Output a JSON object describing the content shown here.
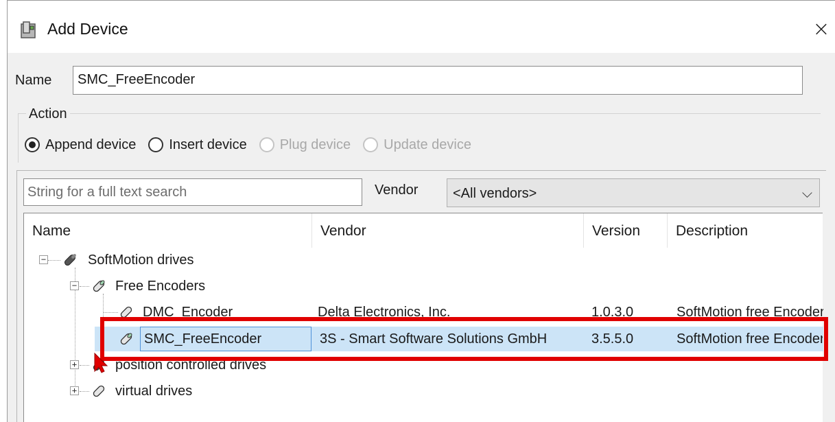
{
  "window": {
    "title": "Add Device",
    "close_glyph": "×"
  },
  "name_field": {
    "label": "Name",
    "value": "SMC_FreeEncoder"
  },
  "action": {
    "label": "Action",
    "options": [
      {
        "label": "Append device",
        "checked": true,
        "disabled": false
      },
      {
        "label": "Insert device",
        "checked": false,
        "disabled": false
      },
      {
        "label": "Plug device",
        "checked": false,
        "disabled": true
      },
      {
        "label": "Update device",
        "checked": false,
        "disabled": true
      }
    ]
  },
  "search": {
    "placeholder": "String for a full text search"
  },
  "vendor": {
    "label": "Vendor",
    "selected": "<All vendors>",
    "chevron": "⌵"
  },
  "table": {
    "columns": [
      "Name",
      "Vendor",
      "Version",
      "Description"
    ],
    "tree": {
      "softmotion_drives": "SoftMotion drives",
      "free_encoders": "Free Encoders",
      "dmc_encoder": {
        "name": "DMC_Encoder",
        "vendor": "Delta Electronics, Inc.",
        "version": "1.0.3.0",
        "description": "SoftMotion free Encoder"
      },
      "smc_free_encoder": {
        "name": "SMC_FreeEncoder",
        "vendor": "3S - Smart Software Solutions GmbH",
        "version": "3.5.5.0",
        "description": "SoftMotion free Encoder"
      },
      "position_controlled": "position controlled drives",
      "virtual_drives": "virtual drives"
    },
    "expander_minus": "−",
    "expander_plus": "+"
  },
  "colors": {
    "highlight": "#e00000",
    "selection": "#cce4f7",
    "selection_border": "#4d90d8"
  },
  "icons": [
    "add-device-icon",
    "close-icon",
    "drive-icon",
    "chevron-down-icon"
  ]
}
